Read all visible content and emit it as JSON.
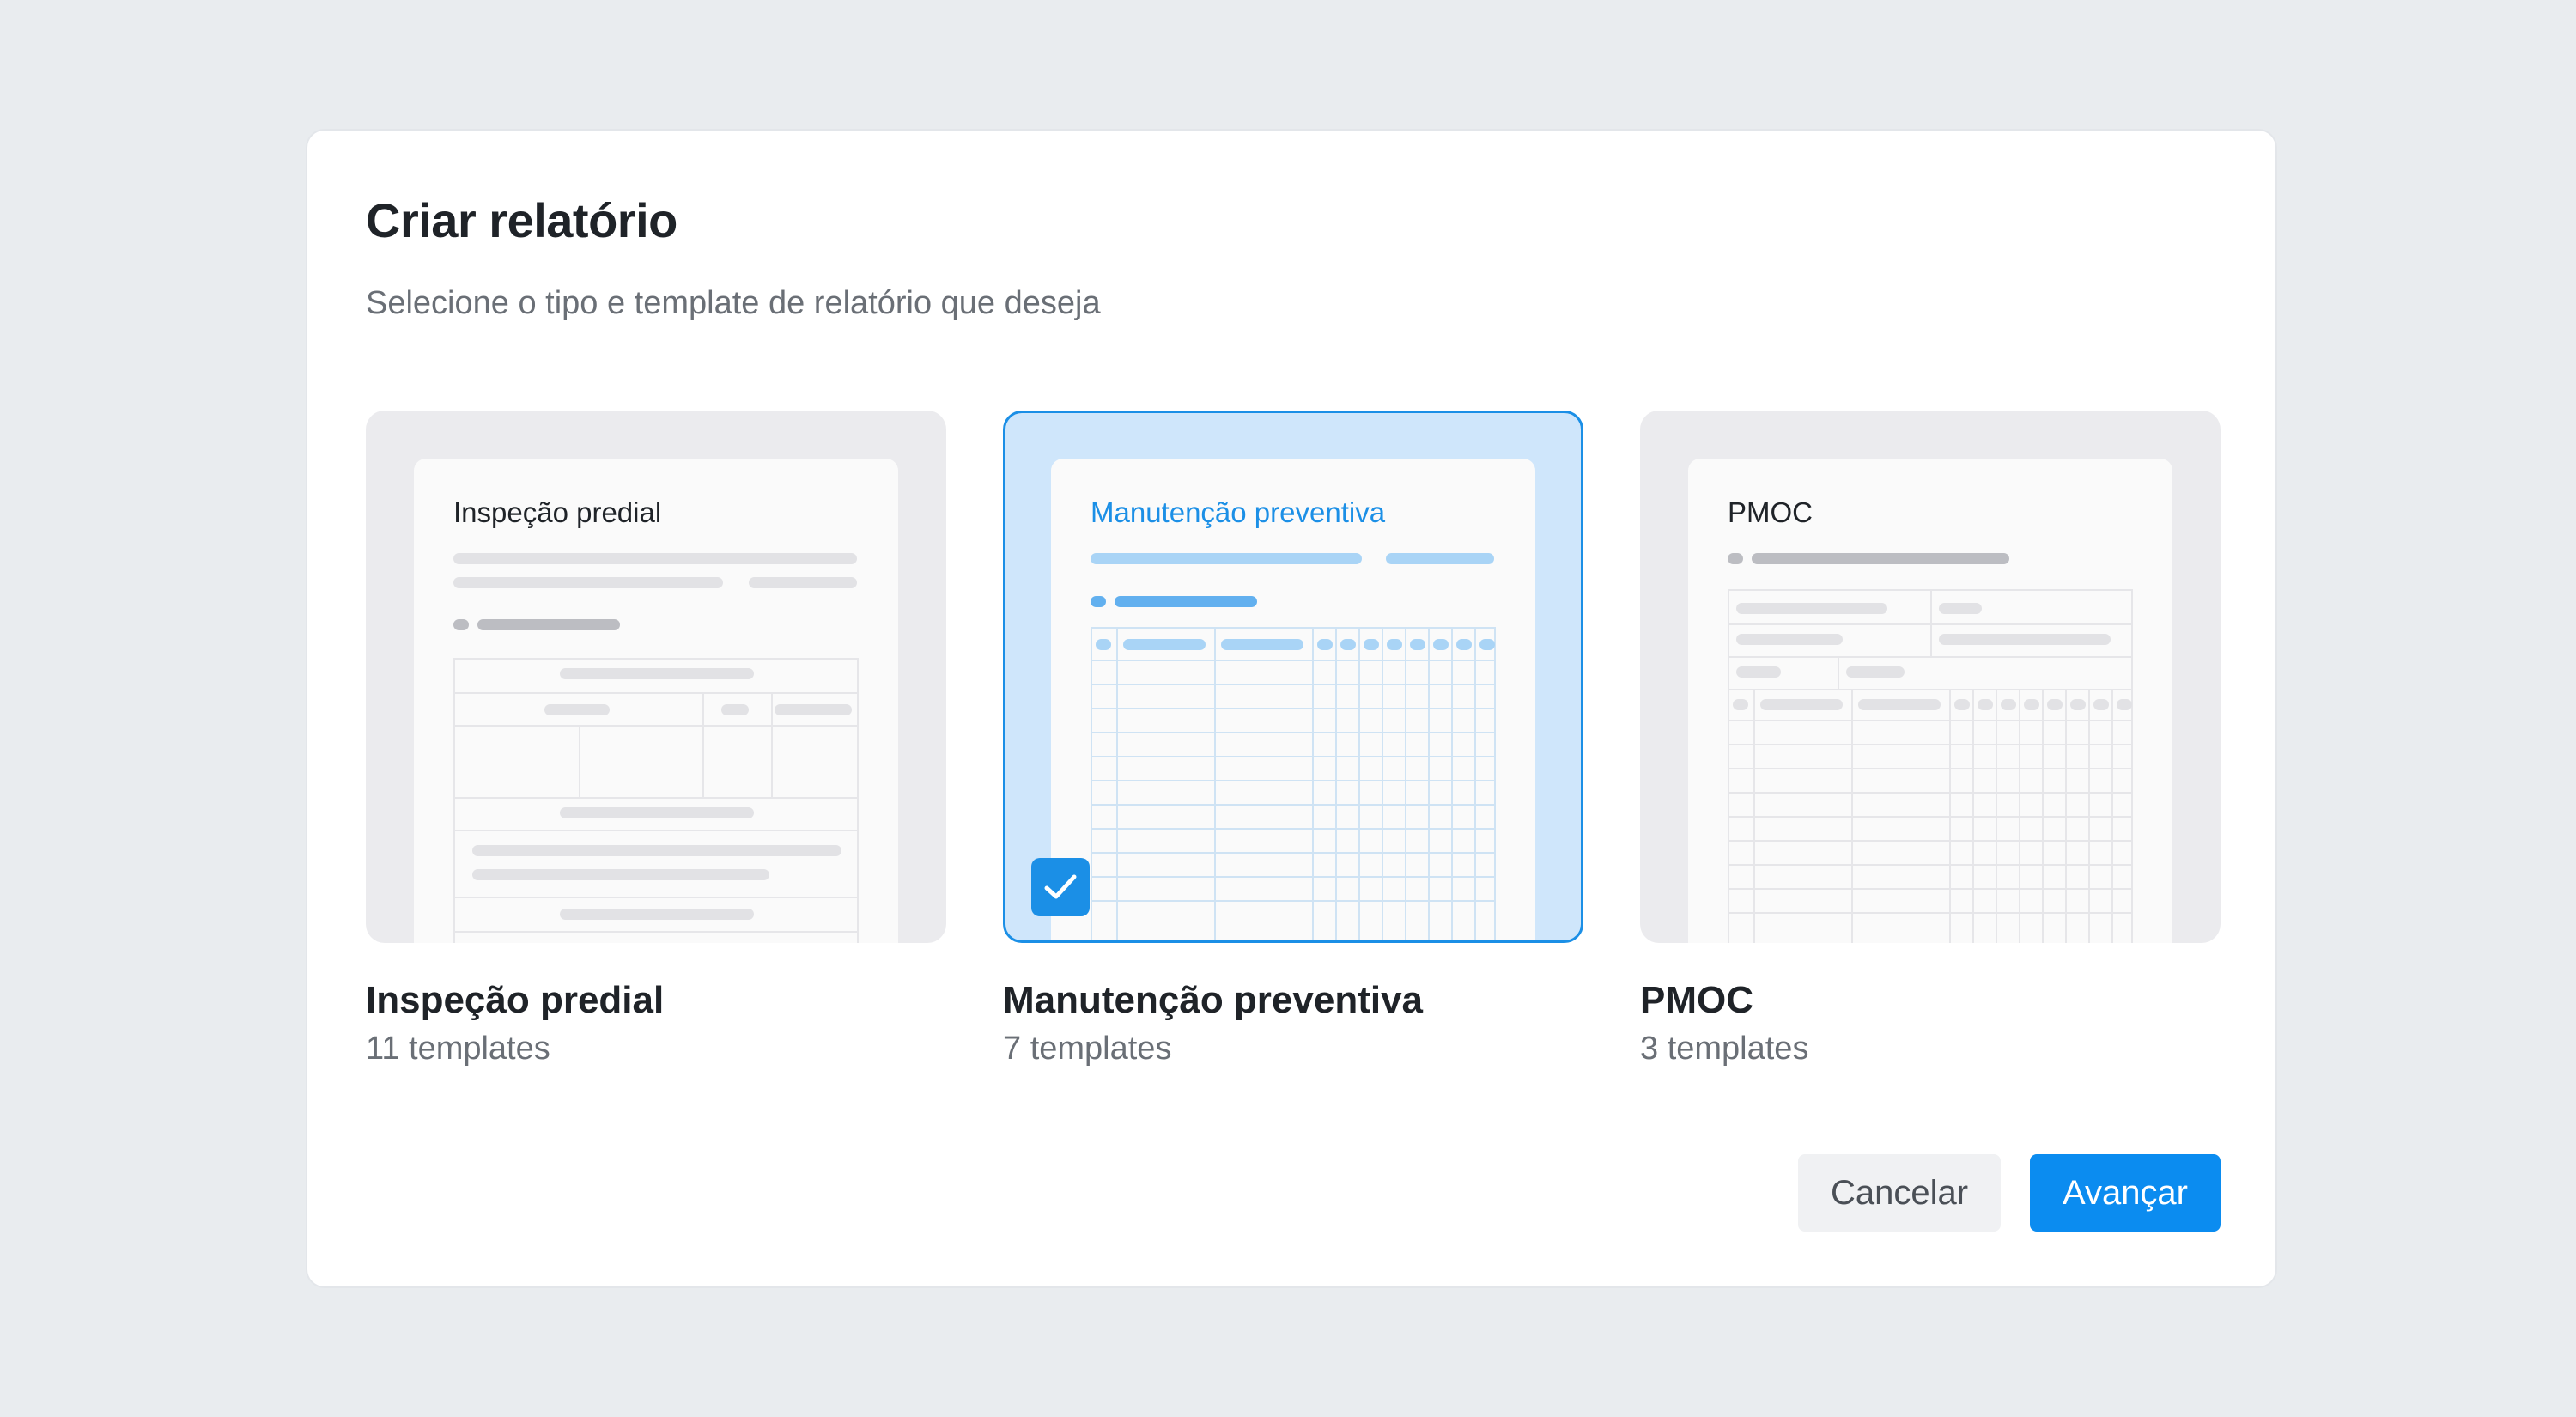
{
  "dialog": {
    "title": "Criar relatório",
    "subtitle": "Selecione o tipo e template de relatório que deseja"
  },
  "report_types": [
    {
      "preview_title": "Inspeção predial",
      "name": "Inspeção predial",
      "count": "11 templates",
      "selected": false
    },
    {
      "preview_title": "Manutenção preventiva",
      "name": "Manutenção preventiva",
      "count": "7 templates",
      "selected": true
    },
    {
      "preview_title": "PMOC",
      "name": "PMOC",
      "count": "3 templates",
      "selected": false
    }
  ],
  "actions": {
    "cancel_label": "Cancelar",
    "next_label": "Avançar"
  },
  "colors": {
    "accent": "#0b8cf0",
    "selected_bg": "#cfe6fb",
    "background": "#e9ecef"
  },
  "icons": {
    "selected_marker": "checkbox-checked-icon"
  }
}
